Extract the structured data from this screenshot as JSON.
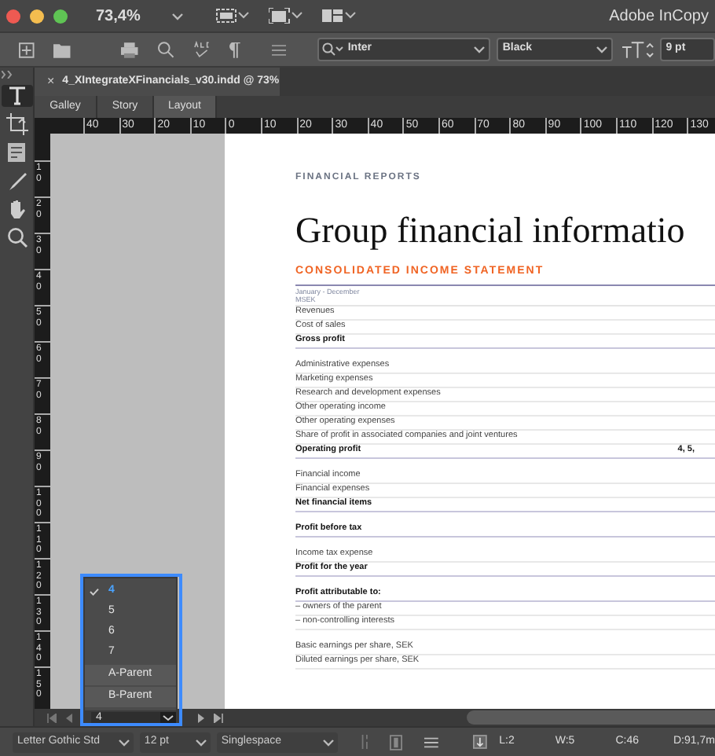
{
  "app": {
    "zoom": "73,4%",
    "title": "Adobe InCopy"
  },
  "toolbar": {
    "font": "Inter",
    "style": "Black",
    "size": "9 pt"
  },
  "tools": [
    {
      "kind": "type",
      "selected": true
    },
    {
      "kind": "position",
      "selected": false
    },
    {
      "kind": "note",
      "selected": false
    },
    {
      "kind": "eyedropper",
      "selected": false
    },
    {
      "kind": "hand",
      "selected": false
    },
    {
      "kind": "zoom",
      "selected": false
    }
  ],
  "document_tab": {
    "close": "×",
    "title": "4_XIntegrateXFinancials_v30.indd @ 73%"
  },
  "view_tabs": [
    {
      "label": "Galley",
      "selected": false
    },
    {
      "label": "Story",
      "selected": false
    },
    {
      "label": "Layout",
      "selected": true
    }
  ],
  "ruler": {
    "horizontal": [
      "40",
      "30",
      "20",
      "10",
      "0",
      "10",
      "20",
      "30",
      "40",
      "50",
      "60",
      "70",
      "80",
      "90",
      "100",
      "110",
      "120",
      "130"
    ],
    "vertical": [
      "10",
      "20",
      "30",
      "40",
      "50",
      "60",
      "70",
      "80",
      "90",
      "100",
      "110",
      "120",
      "130",
      "140",
      "150"
    ]
  },
  "page": {
    "section": "FINANCIAL REPORTS",
    "title": "Group financial informatio",
    "statement_title": "CONSOLIDATED INCOME STATEMENT",
    "period": "January - December",
    "unit": "MSEK",
    "rows": [
      {
        "label": "Revenues",
        "kind": "item",
        "space_before": false
      },
      {
        "label": "Cost of sales",
        "kind": "item",
        "space_before": false
      },
      {
        "label": "Gross profit",
        "kind": "total",
        "space_before": false
      },
      {
        "label": "Administrative expenses",
        "kind": "item",
        "space_before": true
      },
      {
        "label": "Marketing expenses",
        "kind": "item",
        "space_before": false
      },
      {
        "label": "Research and development expenses",
        "kind": "item",
        "space_before": false
      },
      {
        "label": "Other operating income",
        "kind": "item",
        "space_before": false
      },
      {
        "label": "Other operating expenses",
        "kind": "item",
        "space_before": false
      },
      {
        "label": "Share of profit in associated companies and joint ventures",
        "kind": "item",
        "space_before": false
      },
      {
        "label": "Operating profit",
        "kind": "total",
        "space_before": false,
        "note": "4, 5,"
      },
      {
        "label": "Financial income",
        "kind": "item",
        "space_before": true
      },
      {
        "label": "Financial expenses",
        "kind": "item",
        "space_before": false
      },
      {
        "label": "Net financial items",
        "kind": "total",
        "space_before": false
      },
      {
        "label": "Profit before tax",
        "kind": "total",
        "space_before": true
      },
      {
        "label": "Income tax expense",
        "kind": "item",
        "space_before": true
      },
      {
        "label": "Profit for the year",
        "kind": "total",
        "space_before": false
      },
      {
        "label": "Profit attributable to:",
        "kind": "total",
        "space_before": true
      },
      {
        "label": "– owners of the parent",
        "kind": "item",
        "space_before": false
      },
      {
        "label": "– non-controlling interests",
        "kind": "item",
        "space_before": false
      },
      {
        "label": "Basic earnings per share, SEK",
        "kind": "item",
        "space_before": true
      },
      {
        "label": "Diluted earnings per share, SEK",
        "kind": "item",
        "space_before": false
      }
    ]
  },
  "page_nav": {
    "page": "4",
    "menu": [
      {
        "label": "4",
        "selected": true
      },
      {
        "label": "5",
        "selected": false
      },
      {
        "label": "6",
        "selected": false
      },
      {
        "label": "7",
        "selected": false
      },
      {
        "label": "A-Parent",
        "selected": false,
        "kind": "parent"
      },
      {
        "label": "B-Parent",
        "selected": false,
        "kind": "parent"
      }
    ]
  },
  "status_bar": {
    "font": "Letter Gothic Std",
    "size": "12 pt",
    "spacing": "Singlespace",
    "line": "L:2",
    "words": "W:5",
    "chars": "C:46",
    "depth": "D:91,7m"
  }
}
